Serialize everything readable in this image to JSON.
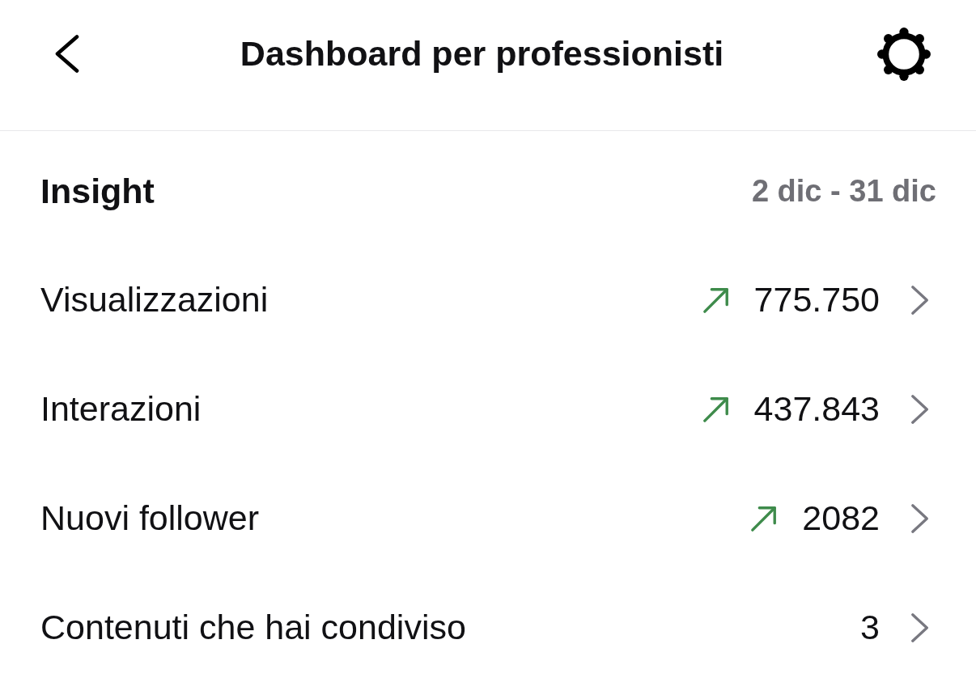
{
  "header": {
    "title": "Dashboard per professionisti"
  },
  "insight": {
    "heading": "Insight",
    "date_range": "2 dic - 31 dic"
  },
  "rows": [
    {
      "label": "Visualizzazioni",
      "value": "775.750",
      "trending_up": true
    },
    {
      "label": "Interazioni",
      "value": "437.843",
      "trending_up": true
    },
    {
      "label": "Nuovi follower",
      "value": "2082",
      "trending_up": true
    },
    {
      "label": "Contenuti che hai condiviso",
      "value": "3",
      "trending_up": false
    }
  ]
}
